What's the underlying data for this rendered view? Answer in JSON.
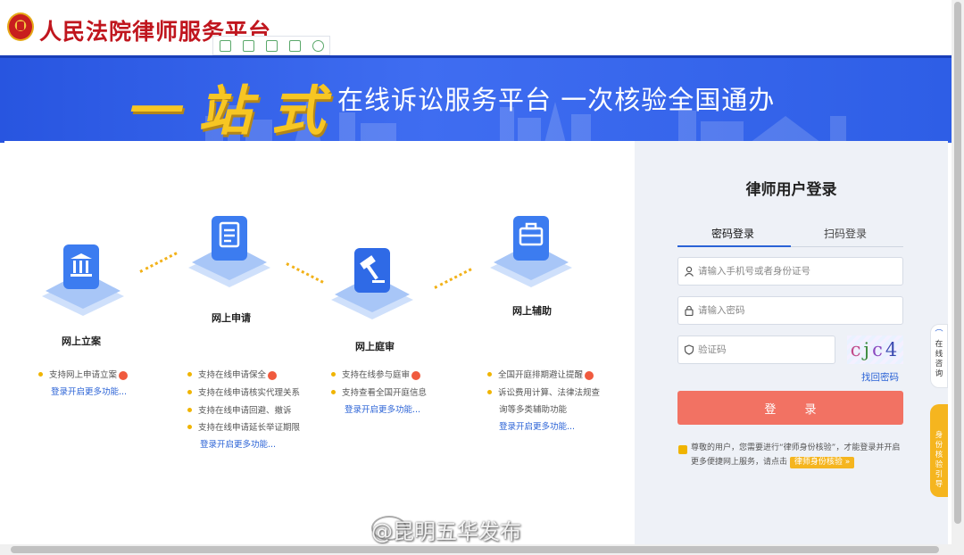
{
  "header": {
    "site_title": "人民法院律师服务平台"
  },
  "banner": {
    "slogan_big": "一站式",
    "slogan_small": "在线诉讼服务平台  一次核验全国通办"
  },
  "steps": [
    {
      "label": "网上立案",
      "icon": "courthouse-icon",
      "features": [
        "支持网上申请立案"
      ],
      "more": "登录开启更多功能..."
    },
    {
      "label": "网上申请",
      "icon": "document-icon",
      "features": [
        "支持在线申请保全",
        "支持在线申请核实代理关系",
        "支持在线申请回避、撤诉",
        "支持在线申请延长举证期限"
      ],
      "more": "登录开启更多功能..."
    },
    {
      "label": "网上庭审",
      "icon": "gavel-icon",
      "features": [
        "支持在线参与庭审",
        "支持查看全国开庭信息"
      ],
      "more": "登录开启更多功能..."
    },
    {
      "label": "网上辅助",
      "icon": "briefcase-icon",
      "features": [
        "全国开庭排期避让提醒",
        "诉讼费用计算、法律法规查",
        "询等多类辅助功能"
      ],
      "more": "登录开启更多功能..."
    }
  ],
  "login": {
    "title": "律师用户登录",
    "tabs": [
      "密码登录",
      "扫码登录"
    ],
    "phone_placeholder": "请输入手机号或者身份证号",
    "password_placeholder": "请输入密码",
    "captcha_placeholder": "验证码",
    "captcha_text": "cjc4",
    "forgot": "找回密码",
    "button": "登 录",
    "notice": "尊敬的用户，您需要进行“律师身份核验”，才能登录并开启更多便捷网上服务，请点击",
    "verify_badge": "律师身份核验 »"
  },
  "float": {
    "consult": "在线咨询",
    "guide": "身份核验引导"
  },
  "watermark": "@昆明五华发布"
}
